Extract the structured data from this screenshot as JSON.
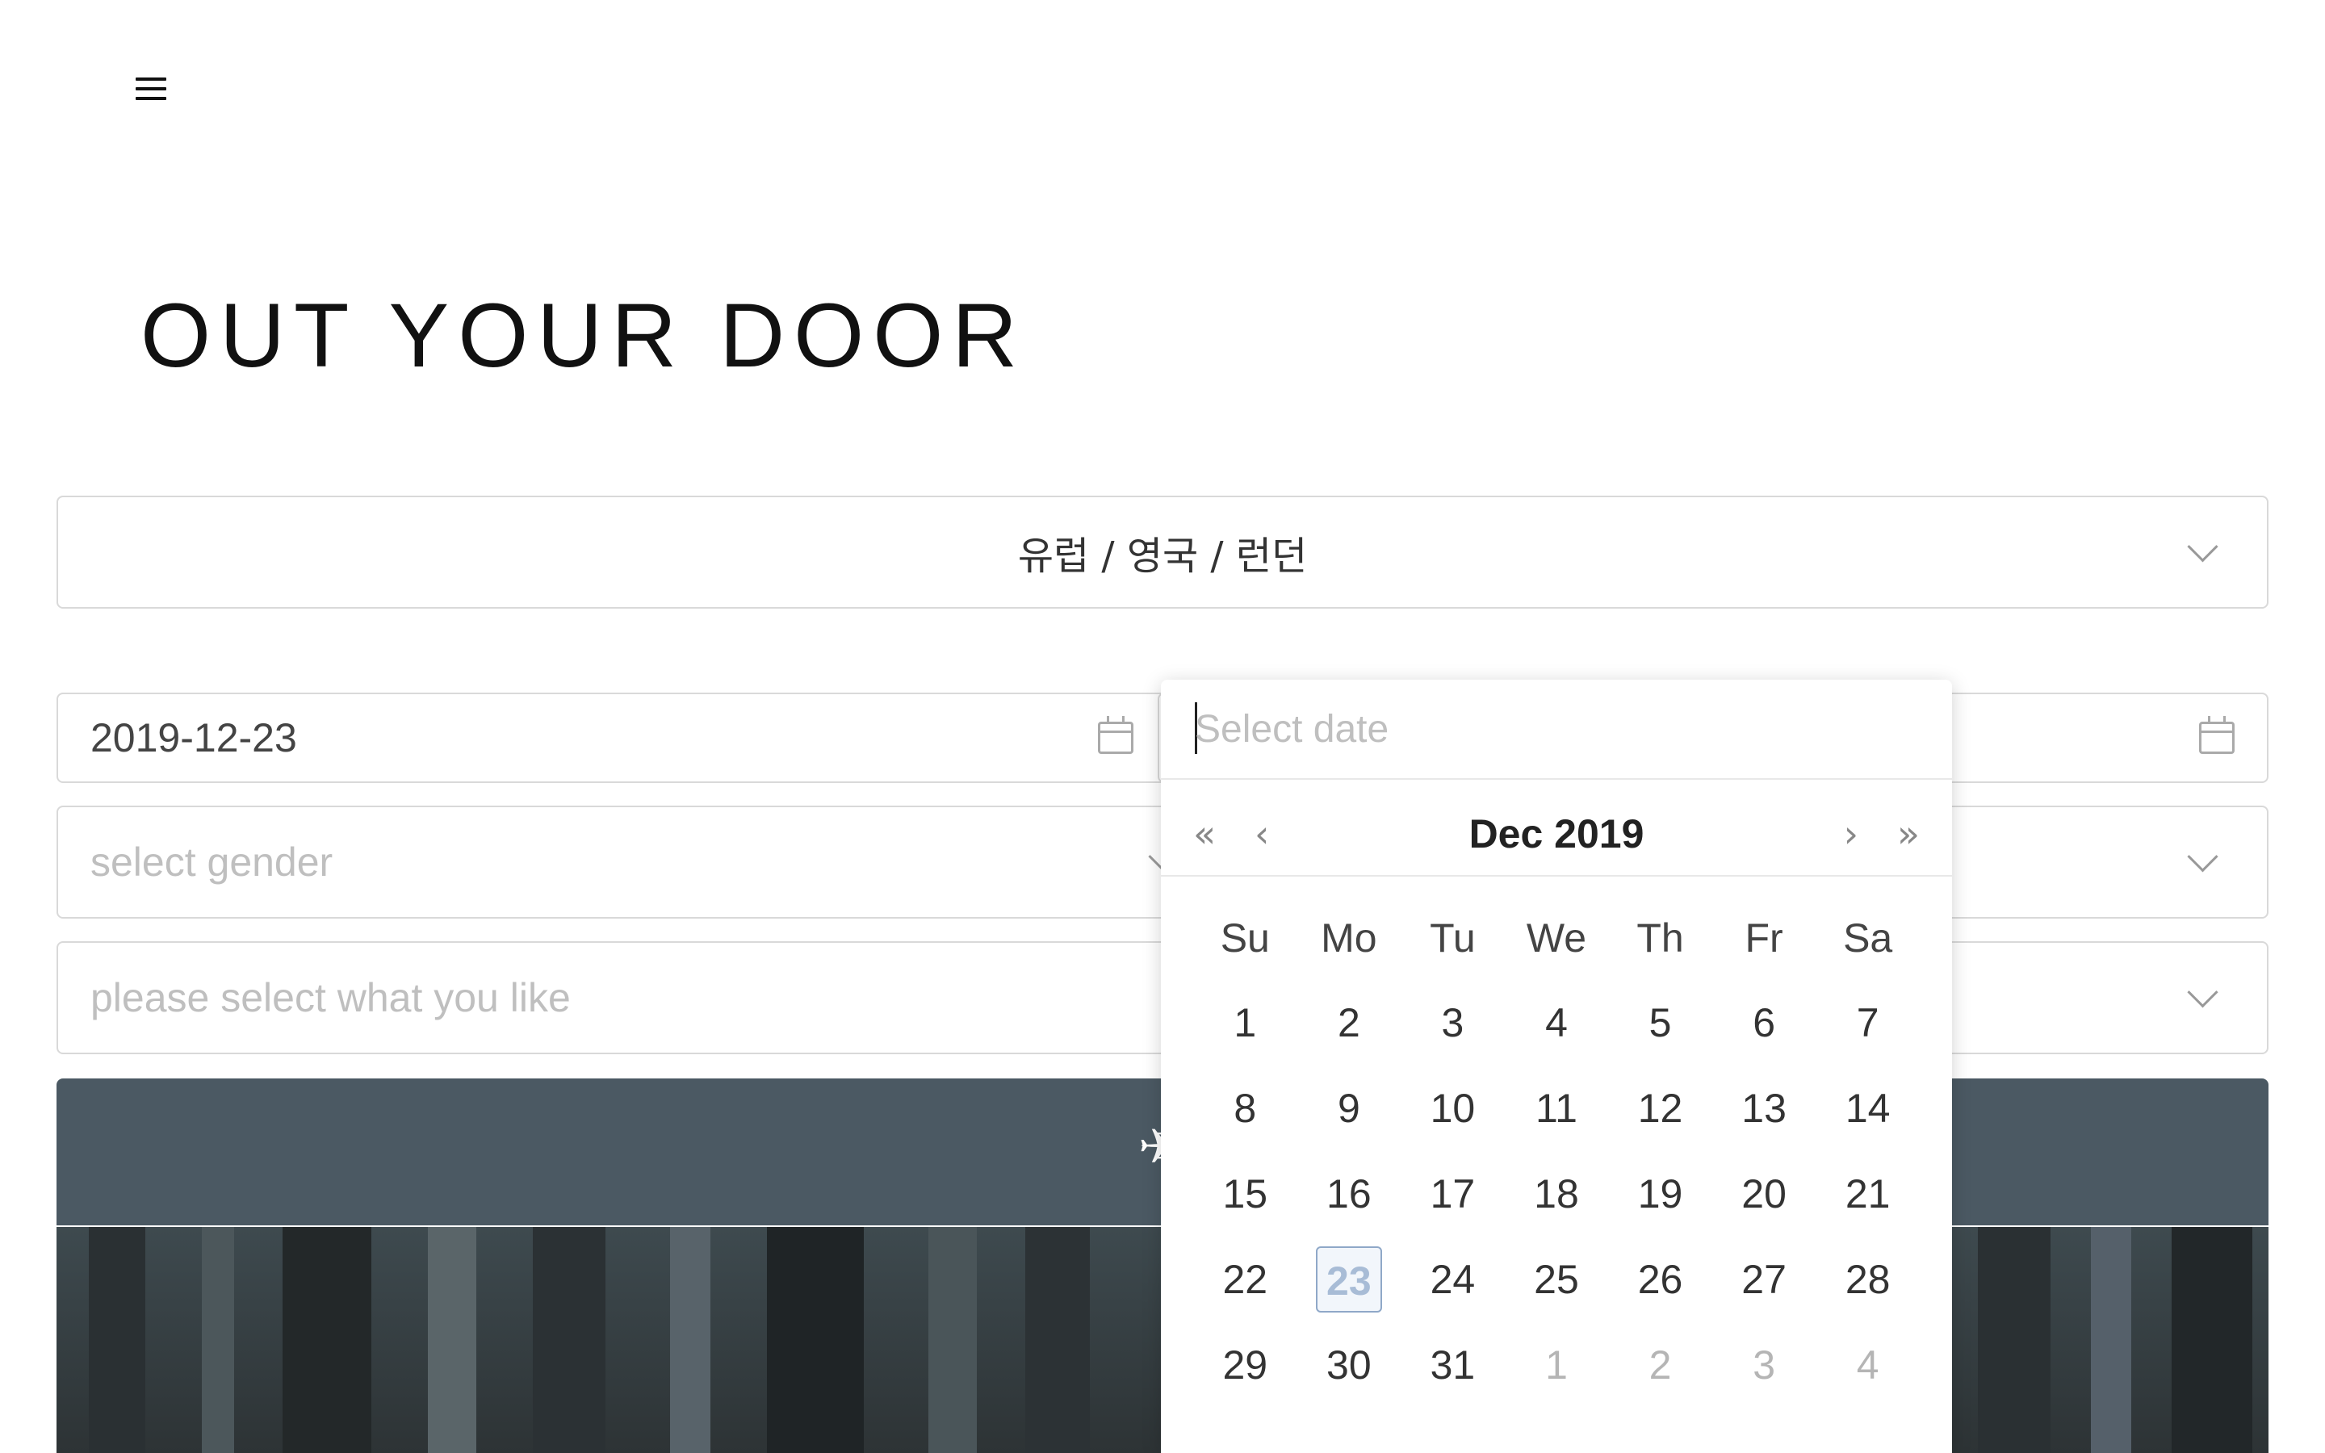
{
  "header": {
    "title": "OUT YOUR DOOR"
  },
  "location": {
    "value": "유럽 / 영국 / 런던"
  },
  "start_date": {
    "value": "2019-12-23"
  },
  "gender": {
    "placeholder": "select gender"
  },
  "interest": {
    "placeholder": "please select what you like"
  },
  "datepicker": {
    "input_placeholder": "Select date",
    "month_label": "Dec 2019",
    "nav": {
      "prev_year": "«",
      "prev_month": "‹",
      "next_month": "›",
      "next_year": "»"
    },
    "weekdays": [
      "Su",
      "Mo",
      "Tu",
      "We",
      "Th",
      "Fr",
      "Sa"
    ],
    "weeks": [
      [
        "1",
        "2",
        "3",
        "4",
        "5",
        "6",
        "7"
      ],
      [
        "8",
        "9",
        "10",
        "11",
        "12",
        "13",
        "14"
      ],
      [
        "15",
        "16",
        "17",
        "18",
        "19",
        "20",
        "21"
      ],
      [
        "22",
        "23",
        "24",
        "25",
        "26",
        "27",
        "28"
      ],
      [
        "29",
        "30",
        "31",
        "1",
        "2",
        "3",
        "4"
      ]
    ],
    "selected_day": "23"
  },
  "search_button": {
    "icon": "plane-icon"
  },
  "colors": {
    "button": "#4b5963",
    "today": "#a8bcd6"
  }
}
